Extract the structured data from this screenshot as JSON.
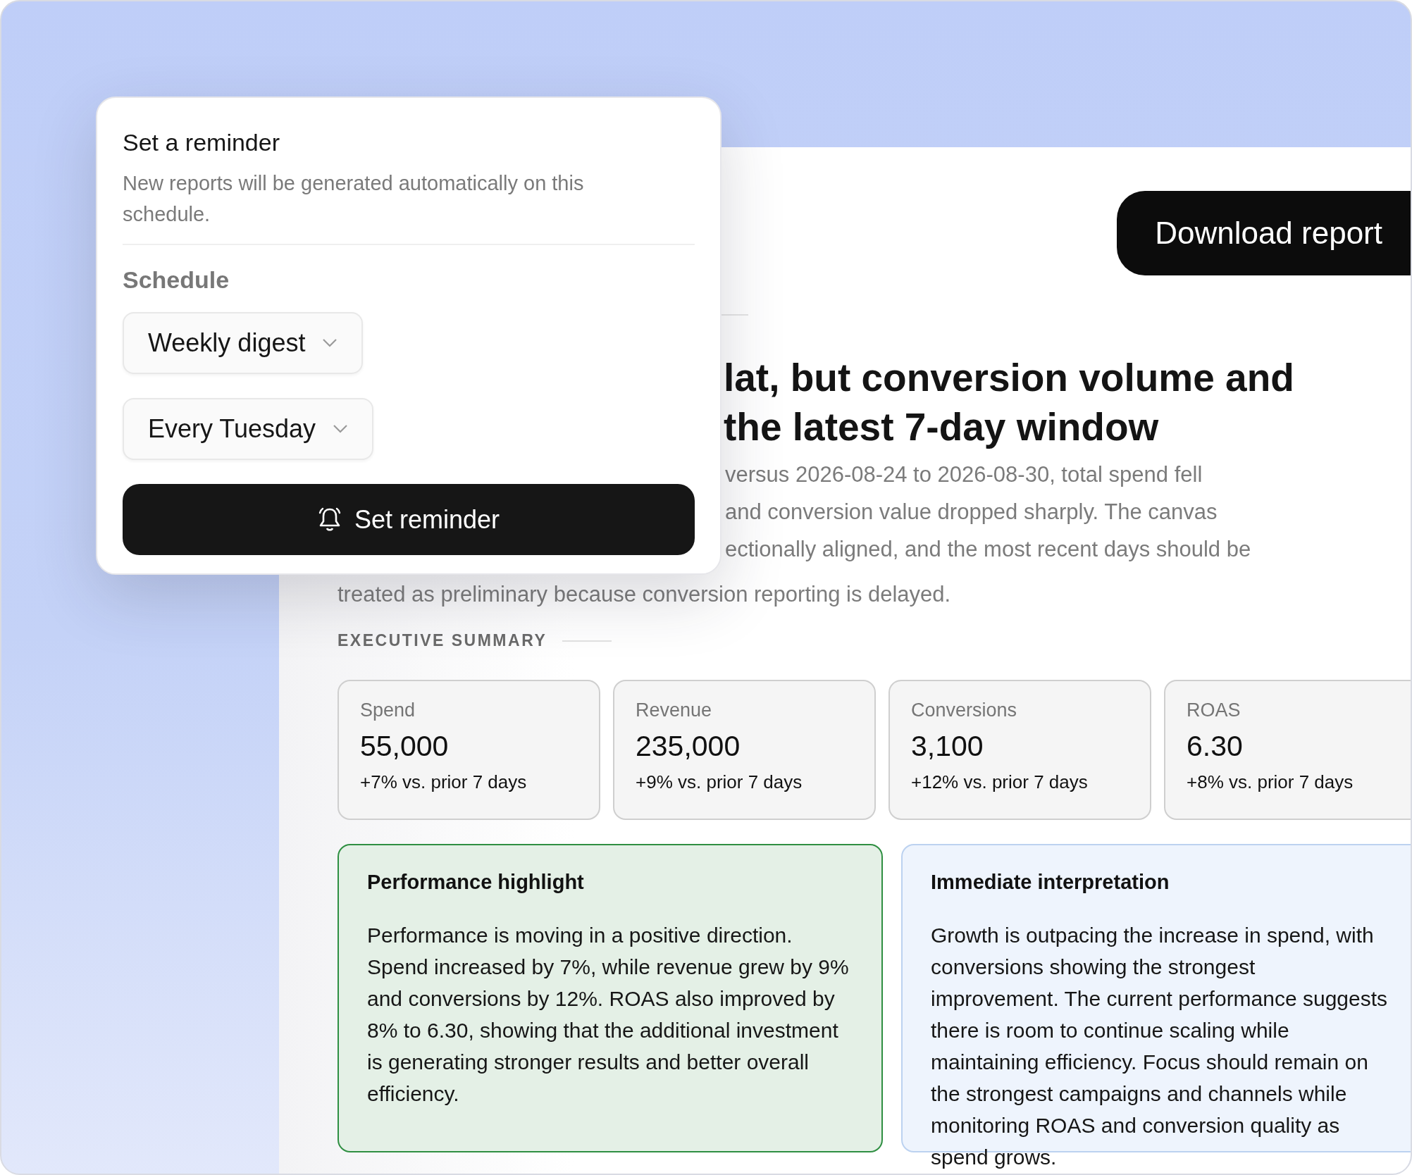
{
  "reminder": {
    "title": "Set a reminder",
    "description": "New reports will be generated automatically on this schedule.",
    "section_label": "Schedule",
    "selects": [
      {
        "value": "Weekly digest"
      },
      {
        "value": "Every Tuesday"
      }
    ],
    "button": "Set reminder"
  },
  "report": {
    "download_button": "Download report",
    "headline_lines": [
      "lat, but conversion volume and",
      "the latest 7-day window"
    ],
    "summary_lines": [
      "versus 2026-08-24 to 2026-08-30, total spend fell",
      "and conversion value dropped sharply. The canvas",
      "ectionally aligned, and the most recent days should be",
      "treated as preliminary because conversion reporting is delayed."
    ],
    "section_label": "EXECUTIVE SUMMARY",
    "metrics": [
      {
        "label": "Spend",
        "value": "55,000",
        "change": "+7% vs. prior 7 days"
      },
      {
        "label": "Revenue",
        "value": "235,000",
        "change": "+9% vs. prior 7 days"
      },
      {
        "label": "Conversions",
        "value": "3,100",
        "change": "+12% vs. prior 7 days"
      },
      {
        "label": "ROAS",
        "value": "6.30",
        "change": "+8% vs. prior 7 days"
      }
    ],
    "insights": [
      {
        "kind": "positive",
        "title": "Performance highlight",
        "body": "Performance is moving in a positive direction. Spend increased by 7%, while revenue grew by 9% and conversions by 12%. ROAS also improved by 8% to 6.30, showing that the additional investment is generating stronger results and better overall efficiency."
      },
      {
        "kind": "info",
        "title": "Immediate interpretation",
        "body": "Growth is outpacing the increase in spend, with conversions showing the strongest improvement. The current performance suggests there is room to continue scaling while maintaining efficiency. Focus should remain on the strongest campaigns and channels while monitoring ROAS and conversion quality as spend grows."
      }
    ]
  }
}
